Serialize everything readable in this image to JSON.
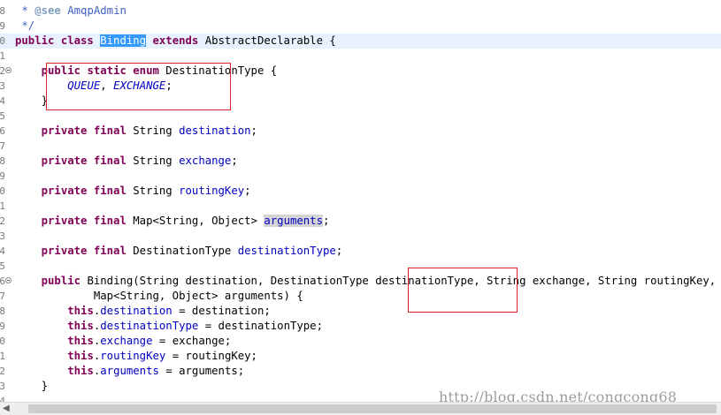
{
  "lines": [
    {
      "num": "8",
      "segs": [
        {
          "t": " * ",
          "c": "jdoc"
        },
        {
          "t": "@see",
          "c": "jtag"
        },
        {
          "t": " AmqpAdmin",
          "c": "jdoc"
        }
      ]
    },
    {
      "num": "9",
      "segs": [
        {
          "t": " */",
          "c": "jdoc"
        }
      ]
    },
    {
      "num": "0",
      "current": true,
      "segs": [
        {
          "t": "public class ",
          "c": "kw"
        },
        {
          "t": "Binding",
          "c": "sel"
        },
        {
          "t": " "
        },
        {
          "t": "extends",
          "c": "kw"
        },
        {
          "t": " AbstractDeclarable {"
        }
      ]
    },
    {
      "num": "1",
      "segs": []
    },
    {
      "num": "2",
      "fold": true,
      "segs": [
        {
          "t": "    "
        },
        {
          "t": "public static enum",
          "c": "kw"
        },
        {
          "t": " DestinationType {"
        }
      ]
    },
    {
      "num": "3",
      "segs": [
        {
          "t": "        "
        },
        {
          "t": "QUEUE",
          "c": "enumc"
        },
        {
          "t": ", "
        },
        {
          "t": "EXCHANGE",
          "c": "enumc"
        },
        {
          "t": ";"
        }
      ]
    },
    {
      "num": "4",
      "segs": [
        {
          "t": "    }"
        }
      ]
    },
    {
      "num": "5",
      "segs": []
    },
    {
      "num": "6",
      "segs": [
        {
          "t": "    "
        },
        {
          "t": "private final",
          "c": "kw"
        },
        {
          "t": " String "
        },
        {
          "t": "destination",
          "c": "fld"
        },
        {
          "t": ";"
        }
      ]
    },
    {
      "num": "7",
      "segs": []
    },
    {
      "num": "8",
      "segs": [
        {
          "t": "    "
        },
        {
          "t": "private final",
          "c": "kw"
        },
        {
          "t": " String "
        },
        {
          "t": "exchange",
          "c": "fld"
        },
        {
          "t": ";"
        }
      ]
    },
    {
      "num": "9",
      "segs": []
    },
    {
      "num": "0",
      "segs": [
        {
          "t": "    "
        },
        {
          "t": "private final",
          "c": "kw"
        },
        {
          "t": " String "
        },
        {
          "t": "routingKey",
          "c": "fld"
        },
        {
          "t": ";"
        }
      ]
    },
    {
      "num": "1",
      "segs": []
    },
    {
      "num": "2",
      "segs": [
        {
          "t": "    "
        },
        {
          "t": "private final",
          "c": "kw"
        },
        {
          "t": " Map<String, Object> "
        },
        {
          "t": "arguments",
          "c": "fld hl"
        },
        {
          "t": ";"
        }
      ]
    },
    {
      "num": "3",
      "segs": []
    },
    {
      "num": "4",
      "segs": [
        {
          "t": "    "
        },
        {
          "t": "private final",
          "c": "kw"
        },
        {
          "t": " DestinationType "
        },
        {
          "t": "destinationType",
          "c": "fld"
        },
        {
          "t": ";"
        }
      ]
    },
    {
      "num": "5",
      "segs": []
    },
    {
      "num": "6",
      "fold": true,
      "segs": [
        {
          "t": "    "
        },
        {
          "t": "public",
          "c": "kw"
        },
        {
          "t": " Binding(String destination, DestinationType destinationType, String exchange, String routingKey,"
        }
      ]
    },
    {
      "num": "7",
      "segs": [
        {
          "t": "            Map<String, Object> arguments) {"
        }
      ]
    },
    {
      "num": "8",
      "segs": [
        {
          "t": "        "
        },
        {
          "t": "this",
          "c": "kw"
        },
        {
          "t": "."
        },
        {
          "t": "destination",
          "c": "fld"
        },
        {
          "t": " = destination;"
        }
      ]
    },
    {
      "num": "9",
      "segs": [
        {
          "t": "        "
        },
        {
          "t": "this",
          "c": "kw"
        },
        {
          "t": "."
        },
        {
          "t": "destinationType",
          "c": "fld"
        },
        {
          "t": " = destinationType;"
        }
      ]
    },
    {
      "num": "0",
      "segs": [
        {
          "t": "        "
        },
        {
          "t": "this",
          "c": "kw"
        },
        {
          "t": "."
        },
        {
          "t": "exchange",
          "c": "fld"
        },
        {
          "t": " = exchange;"
        }
      ]
    },
    {
      "num": "1",
      "segs": [
        {
          "t": "        "
        },
        {
          "t": "this",
          "c": "kw"
        },
        {
          "t": "."
        },
        {
          "t": "routingKey",
          "c": "fld"
        },
        {
          "t": " = routingKey;"
        }
      ]
    },
    {
      "num": "2",
      "segs": [
        {
          "t": "        "
        },
        {
          "t": "this",
          "c": "kw"
        },
        {
          "t": "."
        },
        {
          "t": "arguments",
          "c": "fld"
        },
        {
          "t": " = arguments;"
        }
      ]
    },
    {
      "num": "3",
      "segs": [
        {
          "t": "    }"
        }
      ]
    },
    {
      "num": "4",
      "segs": []
    }
  ],
  "watermark": "http://blog.csdn.net/congcong68",
  "scroll_arrow_icon": "arrow-left-icon",
  "colors": {
    "keyword": "#7f0055",
    "field": "#0000c0",
    "javadoc": "#3f5fbf",
    "selection": "#3399ff",
    "annotation_box": "#e0202b"
  }
}
